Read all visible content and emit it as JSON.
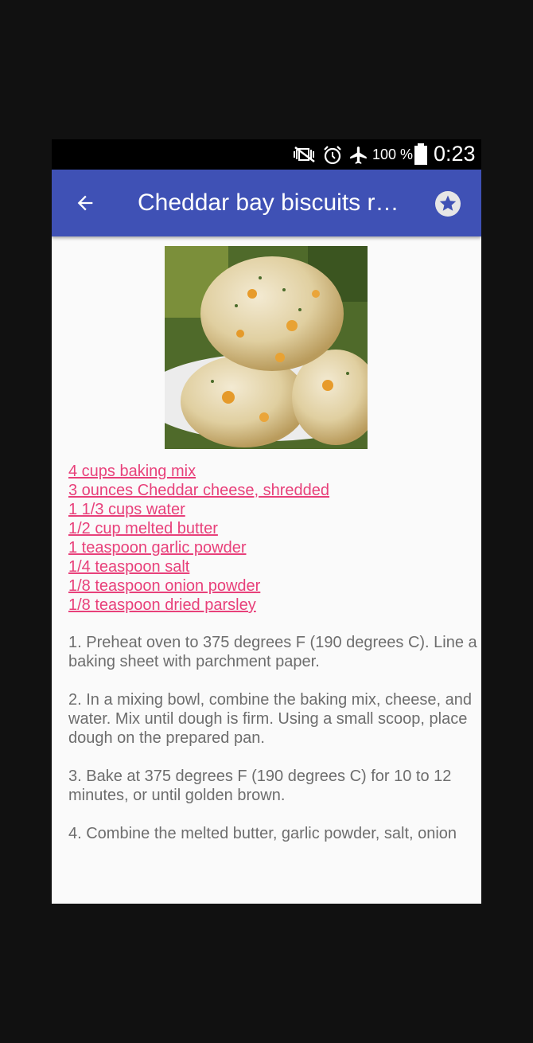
{
  "status_bar": {
    "icons": [
      "mute-vibrate-icon",
      "alarm-icon",
      "airplane-mode-icon",
      "battery-icon"
    ],
    "battery": "100 %",
    "time": "0:23"
  },
  "app_bar": {
    "back_icon": "arrow-back-icon",
    "title": "Cheddar bay biscuits re…",
    "favorite_icon": "star-circle-icon"
  },
  "recipe": {
    "image_alt": "cheddar biscuits photo",
    "ingredients": [
      "4 cups baking mix",
      "3 ounces Cheddar cheese, shredded",
      "1 1/3 cups water",
      "1/2 cup melted butter",
      "1 teaspoon garlic powder",
      "1/4 teaspoon salt",
      "1/8 teaspoon onion powder",
      "1/8 teaspoon dried parsley"
    ],
    "steps": [
      "1. Preheat oven to 375 degrees F (190 degrees C). Line a baking sheet with parchment paper.",
      "2. In a mixing bowl, combine the baking mix, cheese, and water. Mix until dough is firm. Using a small scoop, place dough on the prepared pan.",
      "3. Bake at 375 degrees F (190 degrees C) for 10 to 12 minutes, or until golden brown.",
      "4. Combine the melted butter, garlic powder, salt, onion"
    ]
  },
  "colors": {
    "app_bar": "#3f51b5",
    "link": "#e8407a",
    "body_text": "#6d6d6d"
  }
}
